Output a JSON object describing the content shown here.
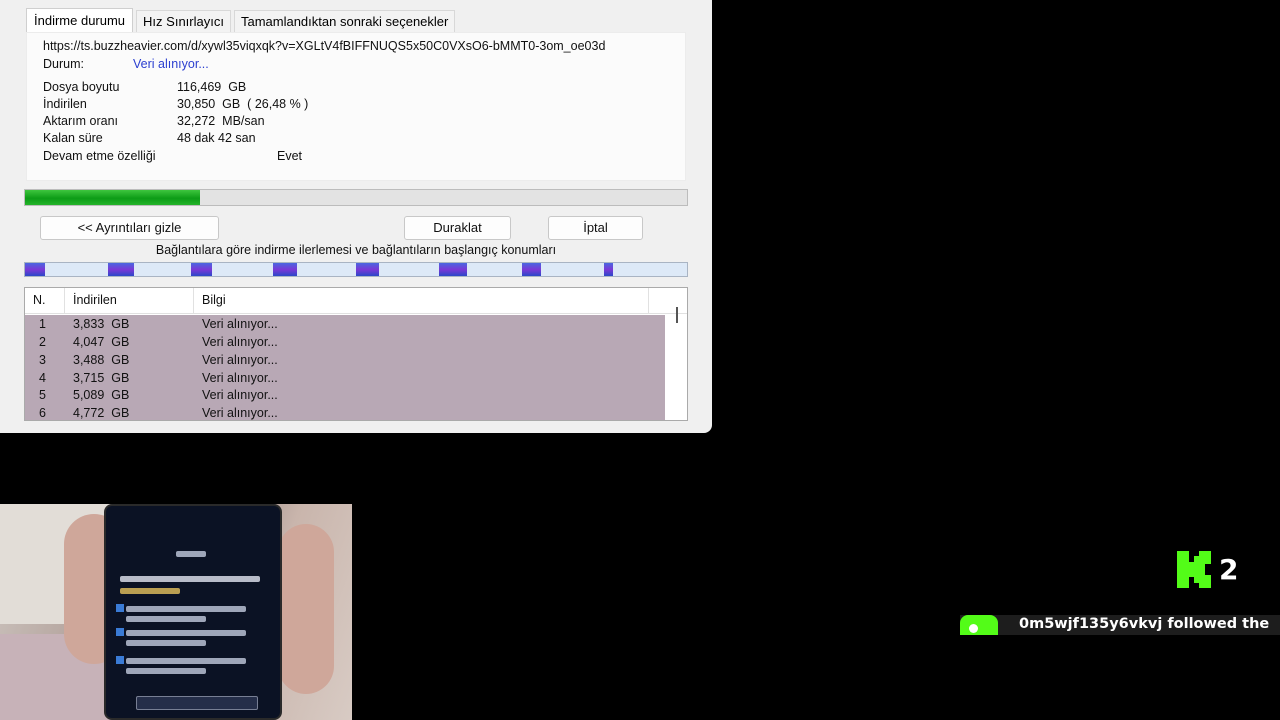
{
  "tabs": [
    {
      "label": "İndirme durumu",
      "active": true
    },
    {
      "label": "Hız Sınırlayıcı",
      "active": false
    },
    {
      "label": "Tamamlandıktan sonraki seçenekler",
      "active": false
    }
  ],
  "info": {
    "url": "https://ts.buzzheavier.com/d/xywl35viqxqk?v=XGLtV4fBIFFNUQS5x50C0VXsO6-bMMT0-3om_oe03d",
    "status_label": "Durum:",
    "status_value": "Veri alınıyor...",
    "rows": [
      {
        "label": "Dosya boyutu",
        "value": "116,469  GB"
      },
      {
        "label": "İndirilen",
        "value": "30,850  GB  ( 26,48 % )"
      },
      {
        "label": "Aktarım oranı",
        "value": "32,272  MB/san"
      },
      {
        "label": "Kalan süre",
        "value": "48 dak 42 san"
      },
      {
        "label": "Devam etme özelliği",
        "value": "Evet"
      }
    ]
  },
  "progress_fraction": 0.2648,
  "buttons": {
    "hide_details": "<< Ayrıntıları gizle",
    "pause": "Duraklat",
    "cancel": "İptal"
  },
  "connections": {
    "caption": "Bağlantılara göre indirme ilerlemesi ve bağlantıların başlangıç konumları",
    "segments": [
      {
        "start": 0.0,
        "fraction": 0.03
      },
      {
        "start": 0.125,
        "fraction": 0.04
      },
      {
        "start": 0.25,
        "fraction": 0.033
      },
      {
        "start": 0.375,
        "fraction": 0.036
      },
      {
        "start": 0.5,
        "fraction": 0.035
      },
      {
        "start": 0.625,
        "fraction": 0.043
      },
      {
        "start": 0.75,
        "fraction": 0.03
      },
      {
        "start": 0.875,
        "fraction": 0.013
      }
    ]
  },
  "table": {
    "headers": [
      "N.",
      "İndirilen",
      "Bilgi"
    ],
    "rows": [
      {
        "n": "1",
        "downloaded": "3,833  GB",
        "info": "Veri alınıyor..."
      },
      {
        "n": "2",
        "downloaded": "4,047  GB",
        "info": "Veri alınıyor..."
      },
      {
        "n": "3",
        "downloaded": "3,488  GB",
        "info": "Veri alınıyor..."
      },
      {
        "n": "4",
        "downloaded": "3,715  GB",
        "info": "Veri alınıyor..."
      },
      {
        "n": "5",
        "downloaded": "5,089  GB",
        "info": "Veri alınıyor..."
      },
      {
        "n": "6",
        "downloaded": "4,772  GB",
        "info": "Veri alınıyor..."
      }
    ]
  },
  "overlay": {
    "kick_icon": "kick-logo-icon",
    "count": "2",
    "follow_message": "0m5wjf135y6vkvj followed the",
    "accent_color": "#53fc18"
  }
}
